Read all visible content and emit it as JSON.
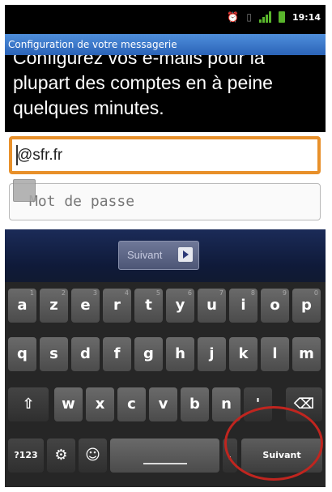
{
  "status_bar": {
    "time": "19:14"
  },
  "title_bar": {
    "title": "Configuration de votre messagerie"
  },
  "instructions": {
    "line1": "Configurez vos e-mails pour la",
    "line2": "plupart des comptes en à peine",
    "line3": "quelques minutes."
  },
  "form": {
    "email_value": "@sfr.fr",
    "password_placeholder": "Mot de passe"
  },
  "action_button": {
    "label": "Suivant"
  },
  "keyboard": {
    "row1": [
      {
        "key": "a",
        "hint": "1"
      },
      {
        "key": "z",
        "hint": "2"
      },
      {
        "key": "e",
        "hint": "3"
      },
      {
        "key": "r",
        "hint": "4"
      },
      {
        "key": "t",
        "hint": "5"
      },
      {
        "key": "y",
        "hint": "6"
      },
      {
        "key": "u",
        "hint": "7"
      },
      {
        "key": "i",
        "hint": "8"
      },
      {
        "key": "o",
        "hint": "9"
      },
      {
        "key": "p",
        "hint": "0"
      }
    ],
    "row2": [
      "q",
      "s",
      "d",
      "f",
      "g",
      "h",
      "j",
      "k",
      "l",
      "m"
    ],
    "row3": [
      "w",
      "x",
      "c",
      "v",
      "b",
      "n"
    ],
    "row3_extra": "'",
    "row4": {
      "symbols": "?123",
      "next_label": "Suivant",
      "comma": ","
    }
  },
  "colors": {
    "title_bar": "#3b77c9",
    "focus_border": "#e8902a",
    "highlight_circle": "#c0251f"
  },
  "icons": [
    "alarm-icon",
    "vibrate-icon",
    "signal-icon",
    "battery-icon",
    "shift-icon",
    "backspace-icon",
    "settings-icon",
    "smiley-icon"
  ]
}
